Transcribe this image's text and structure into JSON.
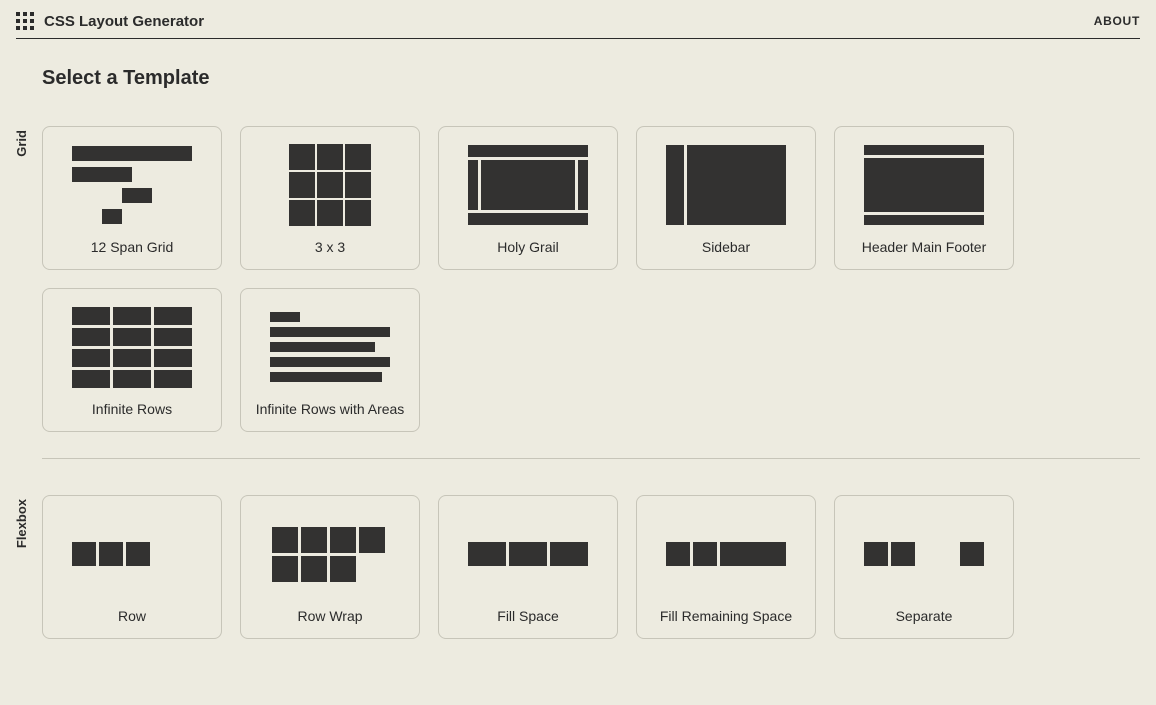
{
  "header": {
    "title": "CSS Layout Generator",
    "about": "ABOUT"
  },
  "page": {
    "heading": "Select a Template"
  },
  "sections": {
    "grid": {
      "label": "Grid",
      "cards": [
        {
          "name": "12 Span Grid"
        },
        {
          "name": "3 x 3"
        },
        {
          "name": "Holy Grail"
        },
        {
          "name": "Sidebar"
        },
        {
          "name": "Header Main Footer"
        },
        {
          "name": "Infinite Rows"
        },
        {
          "name": "Infinite Rows with Areas"
        }
      ]
    },
    "flexbox": {
      "label": "Flexbox",
      "cards": [
        {
          "name": "Row"
        },
        {
          "name": "Row Wrap"
        },
        {
          "name": "Fill Space"
        },
        {
          "name": "Fill Remaining Space"
        },
        {
          "name": "Separate"
        }
      ]
    }
  }
}
